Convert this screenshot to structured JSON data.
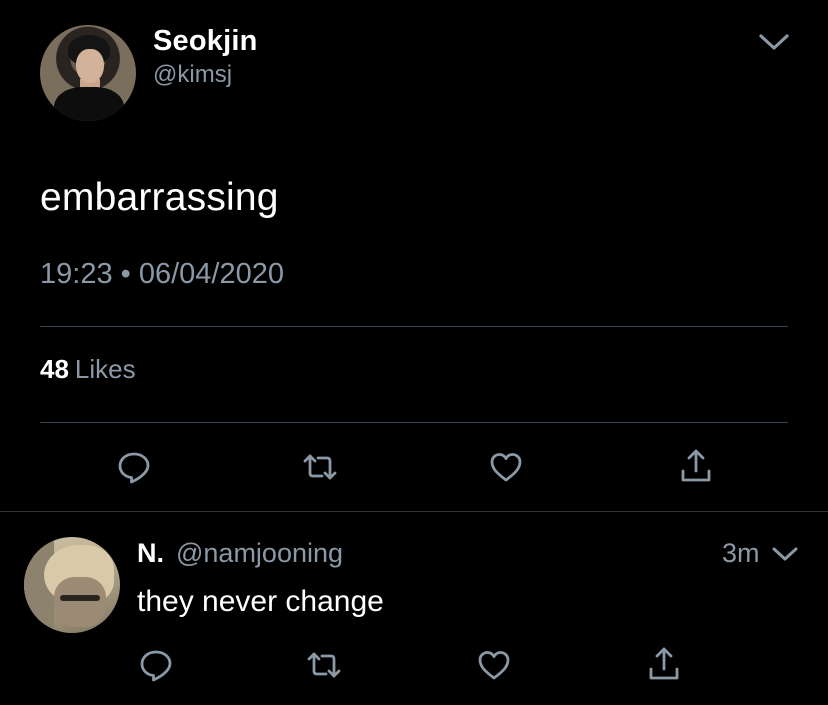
{
  "main_tweet": {
    "display_name": "Seokjin",
    "handle": "@kimsj",
    "text": "embarrassing",
    "timestamp": "19:23 • 06/04/2020",
    "likes_count": "48",
    "likes_label": "Likes",
    "icons": {
      "menu": "chevron-down-icon",
      "reply": "reply-icon",
      "retweet": "retweet-icon",
      "like": "heart-icon",
      "share": "share-icon"
    }
  },
  "reply_tweet": {
    "display_name": "N.",
    "handle": "@namjooning",
    "time": "3m",
    "text": "they never change",
    "icons": {
      "menu": "chevron-down-icon",
      "reply": "reply-icon",
      "retweet": "retweet-icon",
      "like": "heart-icon",
      "share": "share-icon"
    }
  },
  "colors": {
    "background": "#000000",
    "primary_text": "#ffffff",
    "secondary_text": "#8b98a5",
    "divider": "#38444d",
    "icon": "#8b98a5"
  }
}
